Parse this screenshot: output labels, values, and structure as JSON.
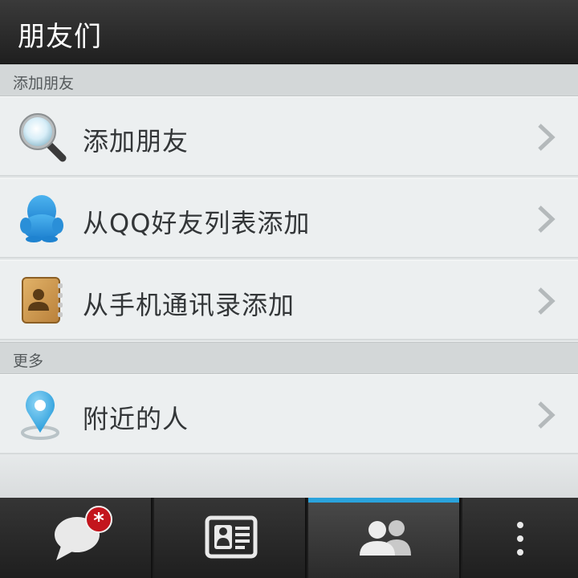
{
  "header": {
    "title": "朋友们"
  },
  "sections": [
    {
      "label": "添加朋友"
    },
    {
      "label": "更多"
    }
  ],
  "rows": [
    {
      "label": "添加朋友",
      "icon": "magnifier-icon"
    },
    {
      "label": "从QQ好友列表添加",
      "icon": "qq-penguin-icon"
    },
    {
      "label": "从手机通讯录添加",
      "icon": "address-book-icon"
    },
    {
      "label": "附近的人",
      "icon": "location-pin-icon"
    }
  ],
  "tabbar": {
    "tabs": [
      {
        "icon": "chat-bubble-icon",
        "badge": "*",
        "active": false
      },
      {
        "icon": "contact-card-icon",
        "active": false
      },
      {
        "icon": "friends-icon",
        "active": true
      },
      {
        "icon": "more-vertical-icon",
        "active": false
      }
    ],
    "accent": "#2aa3dc",
    "badge_color": "#c3151d"
  }
}
